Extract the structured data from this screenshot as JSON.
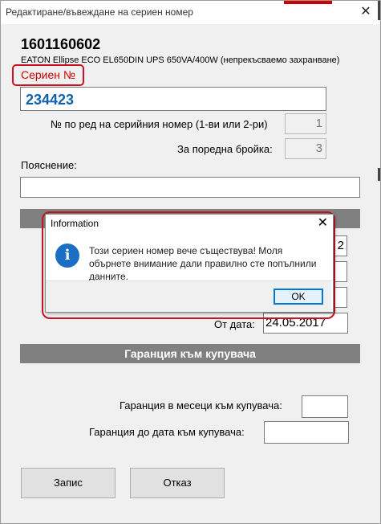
{
  "window": {
    "title": "Редактиране/въвеждане на сериен номер",
    "close": "✕"
  },
  "product": {
    "code": "1601160602",
    "description": "EATON Ellipse ECO EL650DIN UPS 650VA/400W (непрекъсваемо захранване)"
  },
  "serial": {
    "label": "Сериен №",
    "value": "234423"
  },
  "fields": {
    "serial_order_label": "№ по ред на серийния номер (1-ви или 2-ри)",
    "serial_order_value": "1",
    "item_count_label": "За поредна бройка:",
    "item_count_value": "3",
    "note_label": "Пояснение:",
    "note_value": "",
    "partial_value": "2",
    "from_date_label": "От дата:",
    "from_date_value": "24.05.2017"
  },
  "warranty": {
    "section_title": "Гаранция към купувача",
    "months_label": "Гаранция в месеци към купувача:",
    "months_value": "",
    "until_label": "Гаранция до дата към купувача:",
    "until_value": ""
  },
  "buttons": {
    "save": "Запис",
    "cancel": "Отказ"
  },
  "dialog": {
    "title": "Information",
    "close": "✕",
    "icon": "i",
    "message": "Този сериен номер вече съществува! Моля обърнете внимание дали правилно сте попълнили данните.",
    "ok": "OK"
  },
  "colors": {
    "highlight": "#d01020",
    "serial_text": "#1060b0",
    "section_bar": "#808080",
    "info_blue": "#1a6fc4"
  }
}
